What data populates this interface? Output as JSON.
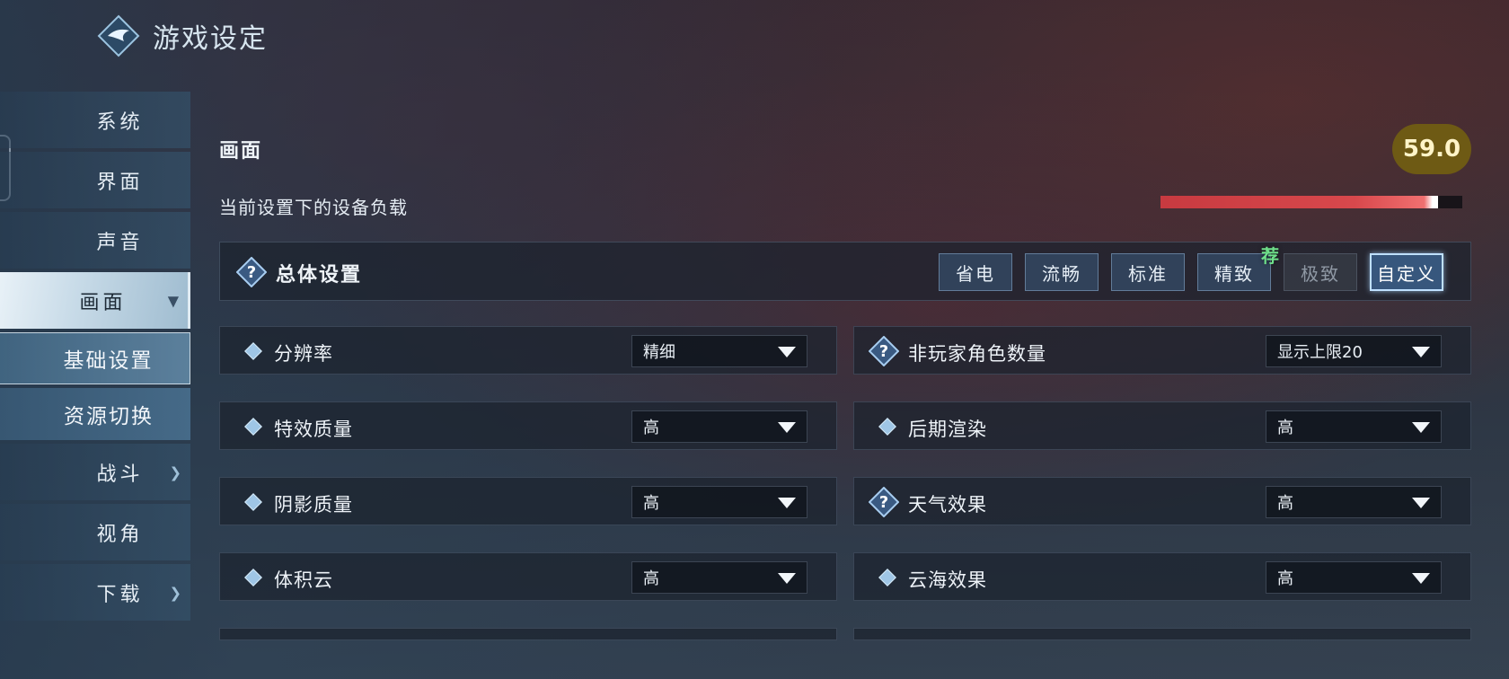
{
  "app": {
    "title": "游戏设定"
  },
  "sidebar": {
    "items": [
      {
        "label": "系统",
        "chevron": false
      },
      {
        "label": "界面",
        "chevron": false
      },
      {
        "label": "声音",
        "chevron": false
      },
      {
        "label": "画面",
        "chevron": true,
        "expanded": true
      },
      {
        "label": "基础设置",
        "sub": true,
        "selected": true
      },
      {
        "label": "资源切换",
        "sub": true
      },
      {
        "label": "战斗",
        "chevron": true
      },
      {
        "label": "视角",
        "chevron": false
      },
      {
        "label": "下载",
        "chevron": true
      }
    ]
  },
  "main": {
    "section_title": "画面",
    "score": "59.0",
    "load_label": "当前设置下的设备负载",
    "load_level": 0.92,
    "overall": {
      "title": "总体设置",
      "presets": [
        {
          "label": "省电",
          "state": "normal"
        },
        {
          "label": "流畅",
          "state": "normal"
        },
        {
          "label": "标准",
          "state": "normal"
        },
        {
          "label": "精致",
          "state": "normal",
          "badge": "荐"
        },
        {
          "label": "极致",
          "state": "disabled"
        },
        {
          "label": "自定义",
          "state": "selected"
        }
      ]
    },
    "settings": [
      {
        "label": "分辨率",
        "value": "精细",
        "icon": "diamond-icon"
      },
      {
        "label": "非玩家角色数量",
        "value": "显示上限20",
        "icon": "help-icon"
      },
      {
        "label": "特效质量",
        "value": "高",
        "icon": "diamond-icon"
      },
      {
        "label": "后期渲染",
        "value": "高",
        "icon": "diamond-icon"
      },
      {
        "label": "阴影质量",
        "value": "高",
        "icon": "diamond-icon"
      },
      {
        "label": "天气效果",
        "value": "高",
        "icon": "help-icon"
      },
      {
        "label": "体积云",
        "value": "高",
        "icon": "diamond-icon"
      },
      {
        "label": "云海效果",
        "value": "高",
        "icon": "diamond-icon"
      }
    ]
  },
  "colors": {
    "score_bg": "#6e5a14",
    "load_fill": "#d8484c",
    "recommend": "#6ee08a"
  }
}
